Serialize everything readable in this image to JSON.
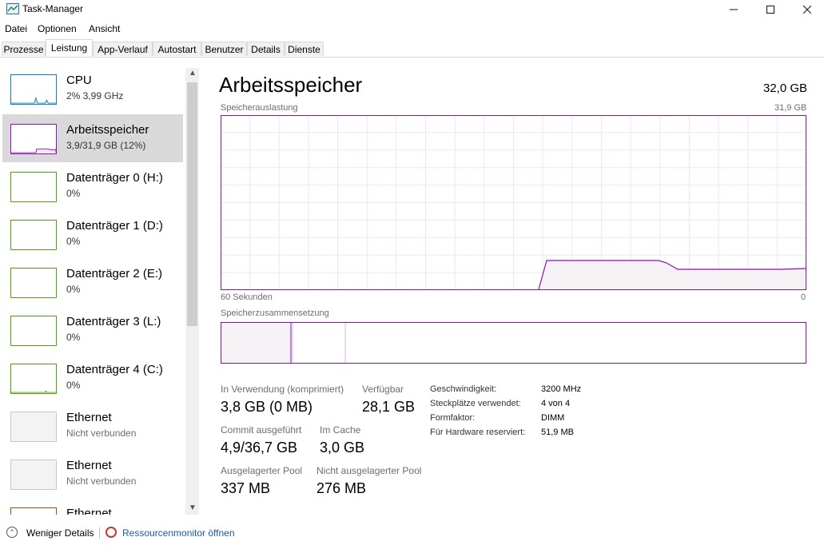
{
  "window": {
    "title": "Task-Manager",
    "controls": {
      "minimize": "—",
      "maximize": "☐",
      "close": "✕"
    }
  },
  "menu": [
    "Datei",
    "Optionen",
    "Ansicht"
  ],
  "tabs": [
    "Prozesse",
    "Leistung",
    "App-Verlauf",
    "Autostart",
    "Benutzer",
    "Details",
    "Dienste"
  ],
  "active_tab": "Leistung",
  "sidebar": {
    "items": [
      {
        "title": "CPU",
        "subtitle": "2% 3,99 GHz",
        "color": "#117dbb",
        "selected": false
      },
      {
        "title": "Arbeitsspeicher",
        "subtitle": "3,9/31,9 GB (12%)",
        "color": "#8b12ae",
        "selected": true
      },
      {
        "title": "Datenträger 0 (H:)",
        "subtitle": "0%",
        "color": "#4da60c",
        "selected": false
      },
      {
        "title": "Datenträger 1 (D:)",
        "subtitle": "0%",
        "color": "#4da60c",
        "selected": false
      },
      {
        "title": "Datenträger 2 (E:)",
        "subtitle": "0%",
        "color": "#4da60c",
        "selected": false
      },
      {
        "title": "Datenträger 3 (L:)",
        "subtitle": "0%",
        "color": "#4da60c",
        "selected": false
      },
      {
        "title": "Datenträger 4 (C:)",
        "subtitle": "0%",
        "color": "#4da60c",
        "selected": false
      },
      {
        "title": "Ethernet",
        "subtitle": "Nicht verbunden",
        "color": "#c8c8c8",
        "selected": false
      },
      {
        "title": "Ethernet",
        "subtitle": "Nicht verbunden",
        "color": "#c8c8c8",
        "selected": false
      },
      {
        "title": "Ethernet",
        "subtitle": "",
        "color": "#a74f01",
        "selected": false
      }
    ],
    "scroll_up": "▲",
    "scroll_down": "▼"
  },
  "main": {
    "title": "Arbeitsspeicher",
    "total": "32,0 GB",
    "chart_label": "Speicherauslastung",
    "chart_max": "31,9 GB",
    "x_left": "60 Sekunden",
    "x_right": "0",
    "composition_label": "Speicherzusammensetzung",
    "accent": "#8b12ae",
    "stats": {
      "in_use_label": "In Verwendung (komprimiert)",
      "in_use_value": "3,8 GB (0 MB)",
      "available_label": "Verfügbar",
      "available_value": "28,1 GB",
      "commit_label": "Commit ausgeführt",
      "commit_value": "4,9/36,7 GB",
      "cached_label": "Im Cache",
      "cached_value": "3,0 GB",
      "paged_label": "Ausgelagerter Pool",
      "paged_value": "337 MB",
      "nonpaged_label": "Nicht ausgelagerter Pool",
      "nonpaged_value": "276 MB"
    },
    "properties": [
      {
        "label": "Geschwindigkeit:",
        "value": "3200 MHz"
      },
      {
        "label": "Steckplätze verwendet:",
        "value": "4 von 4"
      },
      {
        "label": "Formfaktor:",
        "value": "DIMM"
      },
      {
        "label": "Für Hardware reserviert:",
        "value": "51,9 MB"
      }
    ]
  },
  "footer": {
    "fewer_details": "Weniger Details",
    "resource_monitor": "Ressourcenmonitor öffnen"
  }
}
